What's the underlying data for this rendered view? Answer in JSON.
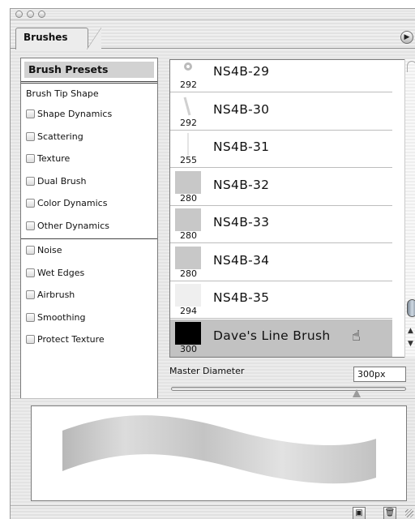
{
  "panel": {
    "tab_label": "Brushes",
    "menu_arrow_glyph": "▶"
  },
  "options": {
    "presets_label": "Brush Presets",
    "tip_shape_label": "Brush Tip Shape",
    "checkbox_items": [
      "Shape Dynamics",
      "Scattering",
      "Texture",
      "Dual Brush",
      "Color Dynamics",
      "Other Dynamics"
    ],
    "checkbox_items_2": [
      "Noise",
      "Wet Edges",
      "Airbrush",
      "Smoothing",
      "Protect Texture"
    ]
  },
  "brushes": [
    {
      "name": "NS4B-29",
      "size": "292",
      "thumb": "spot"
    },
    {
      "name": "NS4B-30",
      "size": "292",
      "thumb": "stroke"
    },
    {
      "name": "NS4B-31",
      "size": "255",
      "thumb": "line"
    },
    {
      "name": "NS4B-32",
      "size": "280",
      "thumb": "gray"
    },
    {
      "name": "NS4B-33",
      "size": "280",
      "thumb": "gray"
    },
    {
      "name": "NS4B-34",
      "size": "280",
      "thumb": "gray"
    },
    {
      "name": "NS4B-35",
      "size": "294",
      "thumb": "light"
    },
    {
      "name": "Dave's Line Brush",
      "size": "300",
      "thumb": "black",
      "selected": true
    }
  ],
  "master_diameter": {
    "label": "Master Diameter",
    "value": "300px",
    "slider_fraction": 0.79
  },
  "colors": {
    "selected_row": "#c2c2c2",
    "black_thumb": "#000000"
  },
  "icons": {
    "scroll_up": "▲",
    "scroll_down": "▼",
    "new_brush": "new-preset-icon",
    "delete": "trash-icon",
    "hand_cursor": "☝"
  }
}
